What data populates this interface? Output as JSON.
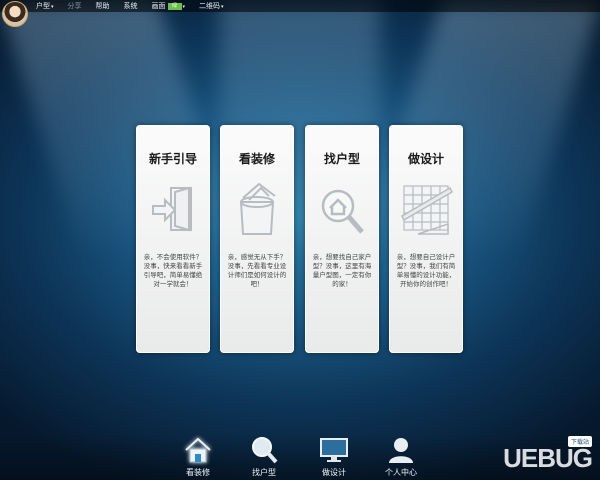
{
  "menu": {
    "items": [
      {
        "label": "户型",
        "caret": "▾",
        "dim": false
      },
      {
        "label": "分享",
        "caret": "",
        "dim": true
      },
      {
        "label": "帮助",
        "caret": "",
        "dim": false
      },
      {
        "label": "系统",
        "caret": "",
        "dim": false
      },
      {
        "label": "画面",
        "caret": "▾",
        "dim": false
      },
      {
        "label": "二维码",
        "caret": "▾",
        "dim": false
      }
    ],
    "skin_badge": "绿"
  },
  "cards": [
    {
      "title": "新手引导",
      "icon": "door-enter-icon",
      "desc": "亲，不会使用软件？没事，快来看看新手引导吧，简单易懂绝对一学就会！"
    },
    {
      "title": "看装修",
      "icon": "paint-bucket-icon",
      "desc": "亲，感觉无从下手？没事，先看看专业设计师们是如何设计的吧！"
    },
    {
      "title": "找户型",
      "icon": "house-search-icon",
      "desc": "亲，想要找自己家户型？没事，这里有海量户型图，一定有你的家！"
    },
    {
      "title": "做设计",
      "icon": "grid-design-icon",
      "desc": "亲，想要自己设计户型？没事，我们有简单易懂的设计功能，开始你的创作吧！"
    }
  ],
  "dock": [
    {
      "label": "看装修",
      "icon": "house-icon",
      "active": true
    },
    {
      "label": "找户型",
      "icon": "magnifier-icon",
      "active": false
    },
    {
      "label": "做设计",
      "icon": "monitor-icon",
      "active": false
    },
    {
      "label": "个人中心",
      "icon": "user-icon",
      "active": false
    }
  ],
  "watermark": {
    "text": "UEBUG",
    "badge": "下载站"
  }
}
